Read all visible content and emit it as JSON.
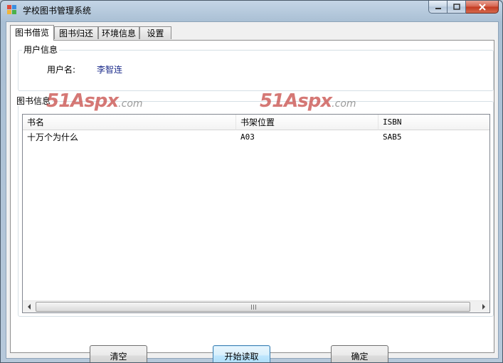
{
  "window": {
    "title": "学校图书管理系统",
    "icon": "app-window-icon",
    "controls": [
      "minimize-icon",
      "maximize-icon",
      "close-icon"
    ]
  },
  "tabs": [
    {
      "label": "图书借览",
      "active": true
    },
    {
      "label": "图书归还",
      "active": false
    },
    {
      "label": "环境信息",
      "active": false
    },
    {
      "label": "设置",
      "active": false
    }
  ],
  "user_group": {
    "title": "用户信息",
    "username_label": "用户名:",
    "username_value": "李智连"
  },
  "book_group": {
    "title": "图书信息"
  },
  "watermark": {
    "brand": "51Aspx",
    "suffix": ".com"
  },
  "table": {
    "columns": [
      "书名",
      "书架位置",
      "ISBN"
    ],
    "rows": [
      [
        "十万个为什么",
        "A03",
        "SAB5"
      ]
    ]
  },
  "buttons": {
    "clear": "清空",
    "start_read": "开始读取",
    "confirm": "确定"
  },
  "colors": {
    "watermark_red": "#c84b48",
    "username_blue": "#1a2a8a",
    "close_red": "#c2391f"
  }
}
